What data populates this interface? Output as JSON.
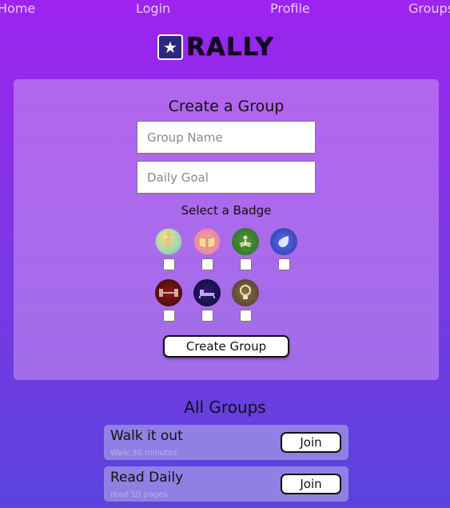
{
  "nav": {
    "home": "Home",
    "login": "Login",
    "profile": "Profile",
    "groups": "Groups"
  },
  "brand": {
    "name": "RALLY",
    "icon": "star-runner-icon"
  },
  "create_group": {
    "title": "Create a Group",
    "group_name_placeholder": "Group Name",
    "daily_goal_placeholder": "Daily Goal",
    "badge_title": "Select a Badge",
    "badges": [
      {
        "icon": "walking-person-icon",
        "checked": false
      },
      {
        "icon": "open-book-icon",
        "checked": false
      },
      {
        "icon": "meditation-icon",
        "checked": false
      },
      {
        "icon": "water-drop-icon",
        "checked": false
      },
      {
        "icon": "dumbbell-icon",
        "checked": false
      },
      {
        "icon": "sleep-bed-icon",
        "checked": false
      },
      {
        "icon": "lightbulb-icon",
        "checked": false
      }
    ],
    "submit_label": "Create Group"
  },
  "all_groups": {
    "title": "All Groups",
    "items": [
      {
        "name": "Walk it out",
        "goal": "Walk 30 minutes",
        "join_label": "Join"
      },
      {
        "name": "Read Daily",
        "goal": "read 10 pages",
        "join_label": "Join"
      }
    ]
  }
}
